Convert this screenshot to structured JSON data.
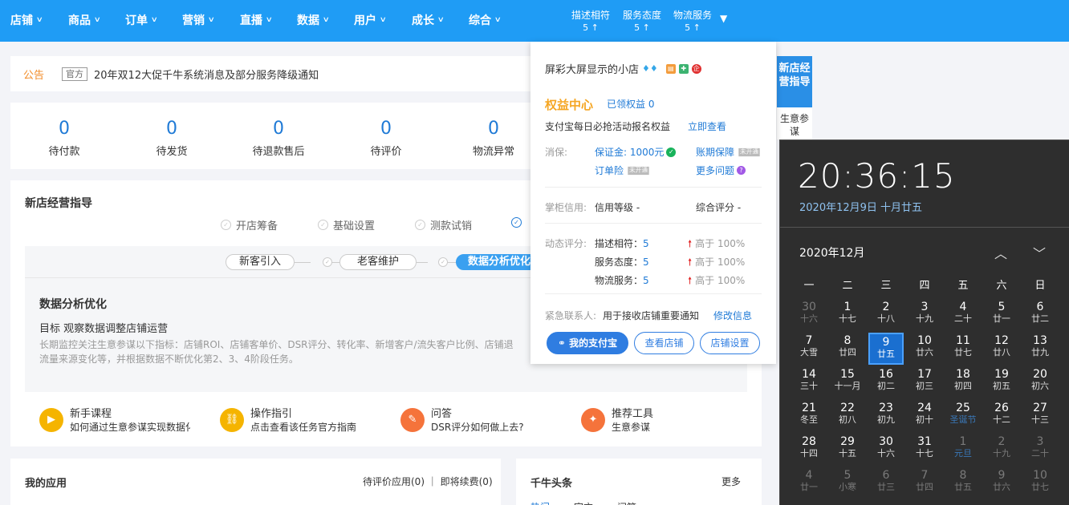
{
  "nav": {
    "items": [
      "店铺",
      "商品",
      "订单",
      "营销",
      "直播",
      "数据",
      "用户",
      "成长",
      "综合"
    ],
    "ratings": [
      {
        "label": "描述相符",
        "value": "5 ↑"
      },
      {
        "label": "服务态度",
        "value": "5 ↑"
      },
      {
        "label": "物流服务",
        "value": "5 ↑"
      }
    ]
  },
  "notice": {
    "label": "公告",
    "tag": "官方",
    "text": "20年双12大促千牛系统消息及部分服务降级通知"
  },
  "stats": [
    {
      "num": "0",
      "label": "待付款"
    },
    {
      "num": "0",
      "label": "待发货"
    },
    {
      "num": "0",
      "label": "待退款售后"
    },
    {
      "num": "0",
      "label": "待评价"
    },
    {
      "num": "0",
      "label": "物流异常"
    }
  ],
  "guide": {
    "title": "新店经营指导",
    "steps": [
      "开店筹备",
      "基础设置",
      "测款试销"
    ],
    "subtabs": [
      "新客引入",
      "老客维护",
      "数据分析优化"
    ],
    "opt_title": "数据分析优化",
    "goal": "目标 观察数据调整店铺运营",
    "desc_line1": "长期监控关注生意参谋以下指标：店铺ROI、店铺客单价、DSR评分、转化率、新增客户/流失客户比例、店铺退",
    "desc_line2": "流量来源变化等，并根据数据不断优化第2、3、4阶段任务。",
    "resources": [
      {
        "title": "新手课程",
        "desc": "如何通过生意参谋实现数据化",
        "color": "#f5b400",
        "icon": "▶"
      },
      {
        "title": "操作指引",
        "desc": "点击查看该任务官方指南",
        "color": "#f5b400",
        "icon": "🔗"
      },
      {
        "title": "问答",
        "desc": "DSR评分如何做上去?",
        "color": "#f5733b",
        "icon": "✎"
      },
      {
        "title": "推荐工具",
        "desc": "生意参谋",
        "color": "#f5733b",
        "icon": "✦"
      }
    ]
  },
  "apps": {
    "title": "我的应用",
    "right": "待评价应用(0) ｜ 即将续费(0)"
  },
  "news": {
    "title": "千牛头条",
    "more": "更多",
    "tabs": [
      "热门",
      "官方",
      "问答"
    ]
  },
  "side": {
    "blue": "新店经营指导",
    "white": "生意参谋"
  },
  "popup": {
    "store_name": "屏彩大屏显示的小店",
    "rights_title": "权益中心",
    "rights_got": "已领权益 0",
    "pay_text": "支付宝每日必抢活动报名权益",
    "pay_link": "立即查看",
    "xiaobao_label": "消保:",
    "deposit": "保证金: 1000元",
    "period_guarantee": "账期保障",
    "not_open": "未开通",
    "order_insurance": "订单险",
    "more_issues": "更多问题",
    "credit_label": "掌柜信用:",
    "credit_level": "信用等级 -",
    "overall_score": "综合评分 -",
    "dynamic_label": "动态评分:",
    "dynamic": [
      {
        "name": "描述相符：",
        "score": "5",
        "cmp": "高于 100%"
      },
      {
        "name": "服务态度：",
        "score": "5",
        "cmp": "高于 100%"
      },
      {
        "name": "物流服务：",
        "score": "5",
        "cmp": "高于 100%"
      }
    ],
    "contact_label": "紧急联系人:",
    "contact_text": "用于接收店铺重要通知",
    "contact_link": "修改信息",
    "buttons": [
      "我的支付宝",
      "查看店铺",
      "店铺设置"
    ]
  },
  "calendar": {
    "time": "20:36:15",
    "date": "2020年12月9日 十月廿五",
    "month": "2020年12月",
    "weekdays": [
      "一",
      "二",
      "三",
      "四",
      "五",
      "六",
      "日"
    ],
    "days": [
      [
        "30",
        "十六",
        true
      ],
      [
        "1",
        "十七",
        false
      ],
      [
        "2",
        "十八",
        false
      ],
      [
        "3",
        "十九",
        false
      ],
      [
        "4",
        "二十",
        false
      ],
      [
        "5",
        "廿一",
        false
      ],
      [
        "6",
        "廿二",
        false
      ],
      [
        "7",
        "大雪",
        false
      ],
      [
        "8",
        "廿四",
        false
      ],
      [
        "9",
        "廿五",
        false
      ],
      [
        "10",
        "廿六",
        false
      ],
      [
        "11",
        "廿七",
        false
      ],
      [
        "12",
        "廿八",
        false
      ],
      [
        "13",
        "廿九",
        false
      ],
      [
        "14",
        "三十",
        false
      ],
      [
        "15",
        "十一月",
        false
      ],
      [
        "16",
        "初二",
        false
      ],
      [
        "17",
        "初三",
        false
      ],
      [
        "18",
        "初四",
        false
      ],
      [
        "19",
        "初五",
        false
      ],
      [
        "20",
        "初六",
        false
      ],
      [
        "21",
        "冬至",
        false
      ],
      [
        "22",
        "初八",
        false
      ],
      [
        "23",
        "初九",
        false
      ],
      [
        "24",
        "初十",
        false
      ],
      [
        "25",
        "圣诞节",
        false
      ],
      [
        "26",
        "十二",
        false
      ],
      [
        "27",
        "十三",
        false
      ],
      [
        "28",
        "十四",
        false
      ],
      [
        "29",
        "十五",
        false
      ],
      [
        "30",
        "十六",
        false
      ],
      [
        "31",
        "十七",
        false
      ],
      [
        "1",
        "元旦",
        true
      ],
      [
        "2",
        "十九",
        true
      ],
      [
        "3",
        "二十",
        true
      ],
      [
        "4",
        "廿一",
        true
      ],
      [
        "5",
        "小寒",
        true
      ],
      [
        "6",
        "廿三",
        true
      ],
      [
        "7",
        "廿四",
        true
      ],
      [
        "8",
        "廿五",
        true
      ],
      [
        "9",
        "廿六",
        true
      ],
      [
        "10",
        "廿七",
        true
      ]
    ]
  }
}
